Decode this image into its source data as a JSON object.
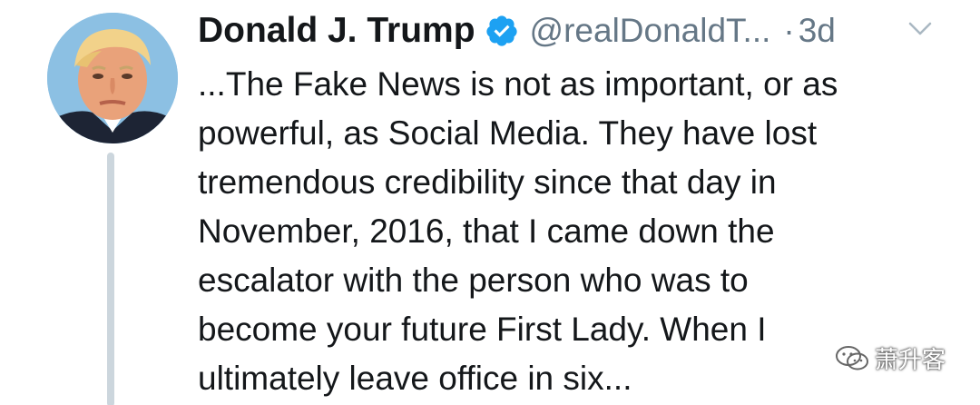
{
  "author": {
    "name": "Donald J. Trump",
    "handle": "@realDonaldT...",
    "time_separator": "·",
    "time": "3d",
    "verified": true
  },
  "tweet": {
    "lines": [
      "...The Fake News is not as important, or as",
      "powerful, as Social Media. They have lost",
      "tremendous credibility since that day in",
      "November, 2016, that I came down the",
      "escalator with the person who was to",
      "become your future First Lady. When I",
      "ultimately leave office in six..."
    ]
  },
  "watermark": {
    "text": "萧升客",
    "icon": "wechat-icon"
  },
  "colors": {
    "text": "#14171a",
    "secondary": "#657786",
    "verified": "#1da1f2",
    "thread_line": "#ccd6dd"
  },
  "icons": {
    "verified": "verified-badge-icon",
    "menu": "chevron-down-icon"
  }
}
